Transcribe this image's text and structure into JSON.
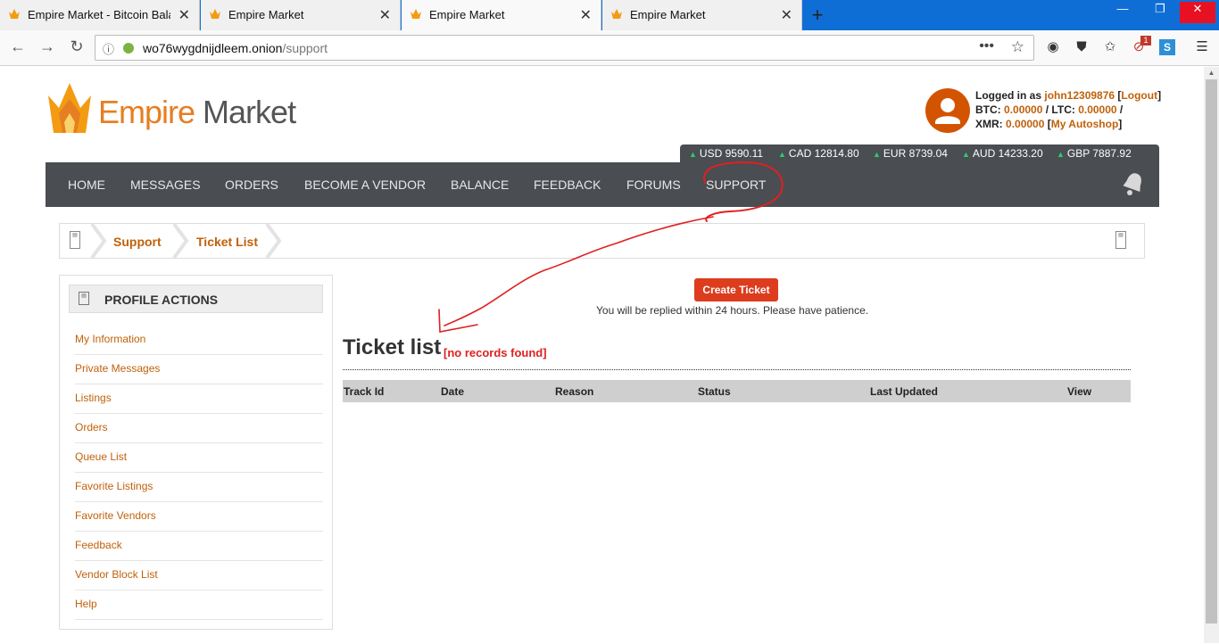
{
  "browser": {
    "tabs": [
      {
        "title": "Empire Market - Bitcoin Balanc",
        "active": false
      },
      {
        "title": "Empire Market",
        "active": false
      },
      {
        "title": "Empire Market",
        "active": true
      },
      {
        "title": "Empire Market",
        "active": false
      }
    ],
    "url_host": "wo76wygdnijdleem.onion",
    "url_path": "/support",
    "new_tab": "+",
    "notification_count": "1"
  },
  "site": {
    "brand_first": "Empire",
    "brand_second": "Market",
    "user": {
      "logged_in_label": "Logged in as",
      "username": "john12309876",
      "logout": "Logout",
      "btc_label": "BTC:",
      "btc": "0.00000",
      "ltc_label": "LTC:",
      "ltc": "0.00000",
      "xmr_label": "XMR:",
      "xmr": "0.00000",
      "autoshop": "My Autoshop"
    },
    "ticker": [
      {
        "label": "USD 9590.11"
      },
      {
        "label": "CAD 12814.80"
      },
      {
        "label": "EUR 8739.04"
      },
      {
        "label": "AUD 14233.20"
      },
      {
        "label": "GBP 7887.92"
      }
    ],
    "nav": [
      "HOME",
      "MESSAGES",
      "ORDERS",
      "BECOME A VENDOR",
      "BALANCE",
      "FEEDBACK",
      "FORUMS",
      "SUPPORT"
    ],
    "breadcrumb": [
      "Support",
      "Ticket List"
    ],
    "sidebar": {
      "heading": "PROFILE ACTIONS",
      "links": [
        "My Information",
        "Private Messages",
        "Listings",
        "Orders",
        "Queue List",
        "Favorite Listings",
        "Favorite Vendors",
        "Feedback",
        "Vendor Block List",
        "Help"
      ]
    },
    "support": {
      "create_button": "Create Ticket",
      "reply_note": "You will be replied within 24 hours. Please have patience.",
      "title": "Ticket list",
      "empty": "[no records found]",
      "columns": [
        "Track Id",
        "Date",
        "Reason",
        "Status",
        "Last Updated",
        "View"
      ]
    }
  },
  "colors": {
    "accent": "#e67e22",
    "link": "#c0610b",
    "nav_bg": "#4a4d52",
    "button": "#dd3c1e",
    "annotation": "#e02020"
  }
}
